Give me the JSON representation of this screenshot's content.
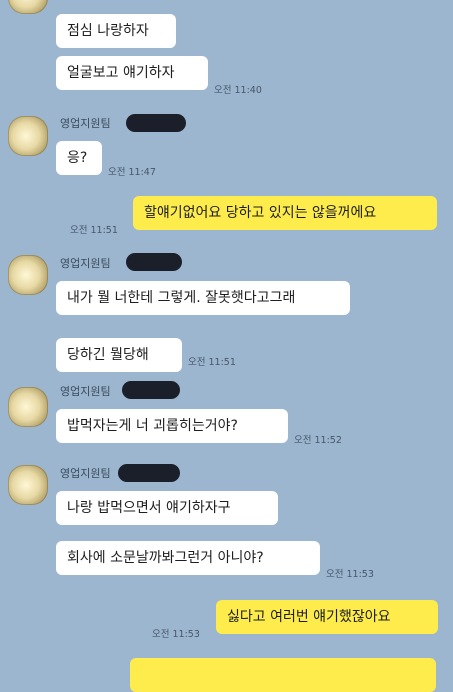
{
  "messages": [
    {
      "side": "in",
      "text": "점심 나랑하자"
    },
    {
      "side": "in",
      "text": "얼굴보고 얘기하자",
      "time": "오전 11:40"
    },
    {
      "side": "in",
      "sender": "영업지원팀",
      "text": "응?",
      "time": "오전 11:47"
    },
    {
      "side": "out",
      "text": "할얘기없어요 당하고 있지는 않을꺼에요",
      "time": "오전 11:51"
    },
    {
      "side": "in",
      "sender": "영업지원팀",
      "text": "내가 뭘 너한테 그렇게. 잘못햇다고그래"
    },
    {
      "side": "in",
      "text": "당하긴 뭘당해",
      "time": "오전 11:51"
    },
    {
      "side": "in",
      "sender": "영업지원팀",
      "text": "밥먹자는게 너 괴롭히는거야?",
      "time": "오전 11:52"
    },
    {
      "side": "in",
      "sender": "영업지원팀",
      "text": "나랑 밥먹으면서 얘기하자구"
    },
    {
      "side": "in",
      "text": "회사에 소문날까봐그런거 아니야?",
      "time": "오전 11:53"
    },
    {
      "side": "out",
      "text": "싫다고 여러번 얘기했잖아요",
      "time": "오전 11:53"
    }
  ],
  "colors": {
    "background": "#9cb6cf",
    "incoming": "#ffffff",
    "outgoing": "#fdec4c"
  }
}
